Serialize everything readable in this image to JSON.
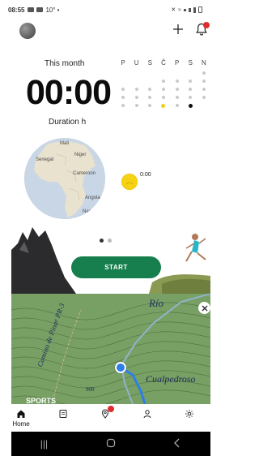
{
  "status_bar": {
    "time": "08:55",
    "temperature": "10°"
  },
  "summary": {
    "period_label": "This month",
    "duration_value": "00:00",
    "duration_label": "Duration h"
  },
  "week_calendar": {
    "days": [
      "P",
      "U",
      "S",
      "Č",
      "P",
      "S",
      "N"
    ],
    "highlight_color": "#f5cf1a"
  },
  "map_preview": {
    "labels": [
      "Mali",
      "Niger",
      "Senegal",
      "Cameroon",
      "Angola",
      "Namib"
    ]
  },
  "sunrise": {
    "time": "0:00"
  },
  "carousel": {
    "pages": 2,
    "active_page": 1
  },
  "start_button": {
    "label": "START",
    "color": "#177f4d"
  },
  "map_card": {
    "labels": [
      "Río",
      "Camino de Pinar PR-3",
      "Cualpedroso",
      "900"
    ],
    "banner_text": "SPORTS"
  },
  "nav": {
    "items": [
      {
        "label": "Home",
        "icon": "home-icon"
      },
      {
        "label": "",
        "icon": "diary-icon"
      },
      {
        "label": "",
        "icon": "map-pin-icon"
      },
      {
        "label": "",
        "icon": "profile-icon"
      },
      {
        "label": "",
        "icon": "settings-icon"
      }
    ]
  }
}
